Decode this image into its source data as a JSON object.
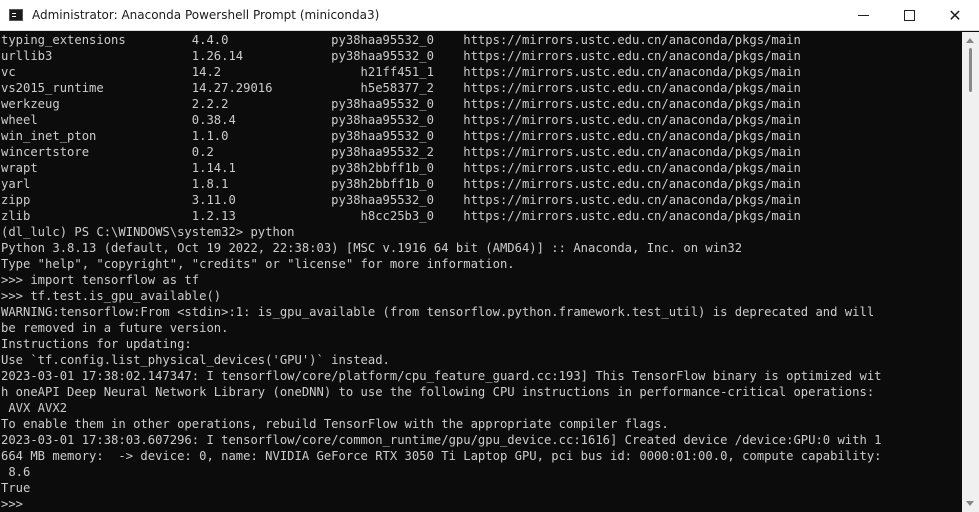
{
  "window": {
    "title": "Administrator: Anaconda Powershell Prompt (miniconda3)"
  },
  "console": {
    "lines": [
      "typing_extensions         4.4.0              py38haa95532_0    https://mirrors.ustc.edu.cn/anaconda/pkgs/main",
      "urllib3                   1.26.14            py38haa95532_0    https://mirrors.ustc.edu.cn/anaconda/pkgs/main",
      "vc                        14.2                   h21ff451_1    https://mirrors.ustc.edu.cn/anaconda/pkgs/main",
      "vs2015_runtime            14.27.29016            h5e58377_2    https://mirrors.ustc.edu.cn/anaconda/pkgs/main",
      "werkzeug                  2.2.2              py38haa95532_0    https://mirrors.ustc.edu.cn/anaconda/pkgs/main",
      "wheel                     0.38.4             py38haa95532_0    https://mirrors.ustc.edu.cn/anaconda/pkgs/main",
      "win_inet_pton             1.1.0              py38haa95532_0    https://mirrors.ustc.edu.cn/anaconda/pkgs/main",
      "wincertstore              0.2                py38haa95532_2    https://mirrors.ustc.edu.cn/anaconda/pkgs/main",
      "wrapt                     1.14.1             py38h2bbff1b_0    https://mirrors.ustc.edu.cn/anaconda/pkgs/main",
      "yarl                      1.8.1              py38h2bbff1b_0    https://mirrors.ustc.edu.cn/anaconda/pkgs/main",
      "zipp                      3.11.0             py38haa95532_0    https://mirrors.ustc.edu.cn/anaconda/pkgs/main",
      "zlib                      1.2.13                 h8cc25b3_0    https://mirrors.ustc.edu.cn/anaconda/pkgs/main",
      "(dl_lulc) PS C:\\WINDOWS\\system32> python",
      "Python 3.8.13 (default, Oct 19 2022, 22:38:03) [MSC v.1916 64 bit (AMD64)] :: Anaconda, Inc. on win32",
      "Type \"help\", \"copyright\", \"credits\" or \"license\" for more information.",
      ">>> import tensorflow as tf",
      ">>> tf.test.is_gpu_available()",
      "WARNING:tensorflow:From <stdin>:1: is_gpu_available (from tensorflow.python.framework.test_util) is deprecated and will",
      "be removed in a future version.",
      "Instructions for updating:",
      "Use `tf.config.list_physical_devices('GPU')` instead.",
      "2023-03-01 17:38:02.147347: I tensorflow/core/platform/cpu_feature_guard.cc:193] This TensorFlow binary is optimized wit",
      "h oneAPI Deep Neural Network Library (oneDNN) to use the following CPU instructions in performance-critical operations:",
      " AVX AVX2",
      "To enable them in other operations, rebuild TensorFlow with the appropriate compiler flags.",
      "2023-03-01 17:38:03.607296: I tensorflow/core/common_runtime/gpu/gpu_device.cc:1616] Created device /device:GPU:0 with 1",
      "664 MB memory:  -> device: 0, name: NVIDIA GeForce RTX 3050 Ti Laptop GPU, pci bus id: 0000:01:00.0, compute capability:",
      " 8.6",
      "True",
      ">>>"
    ]
  }
}
